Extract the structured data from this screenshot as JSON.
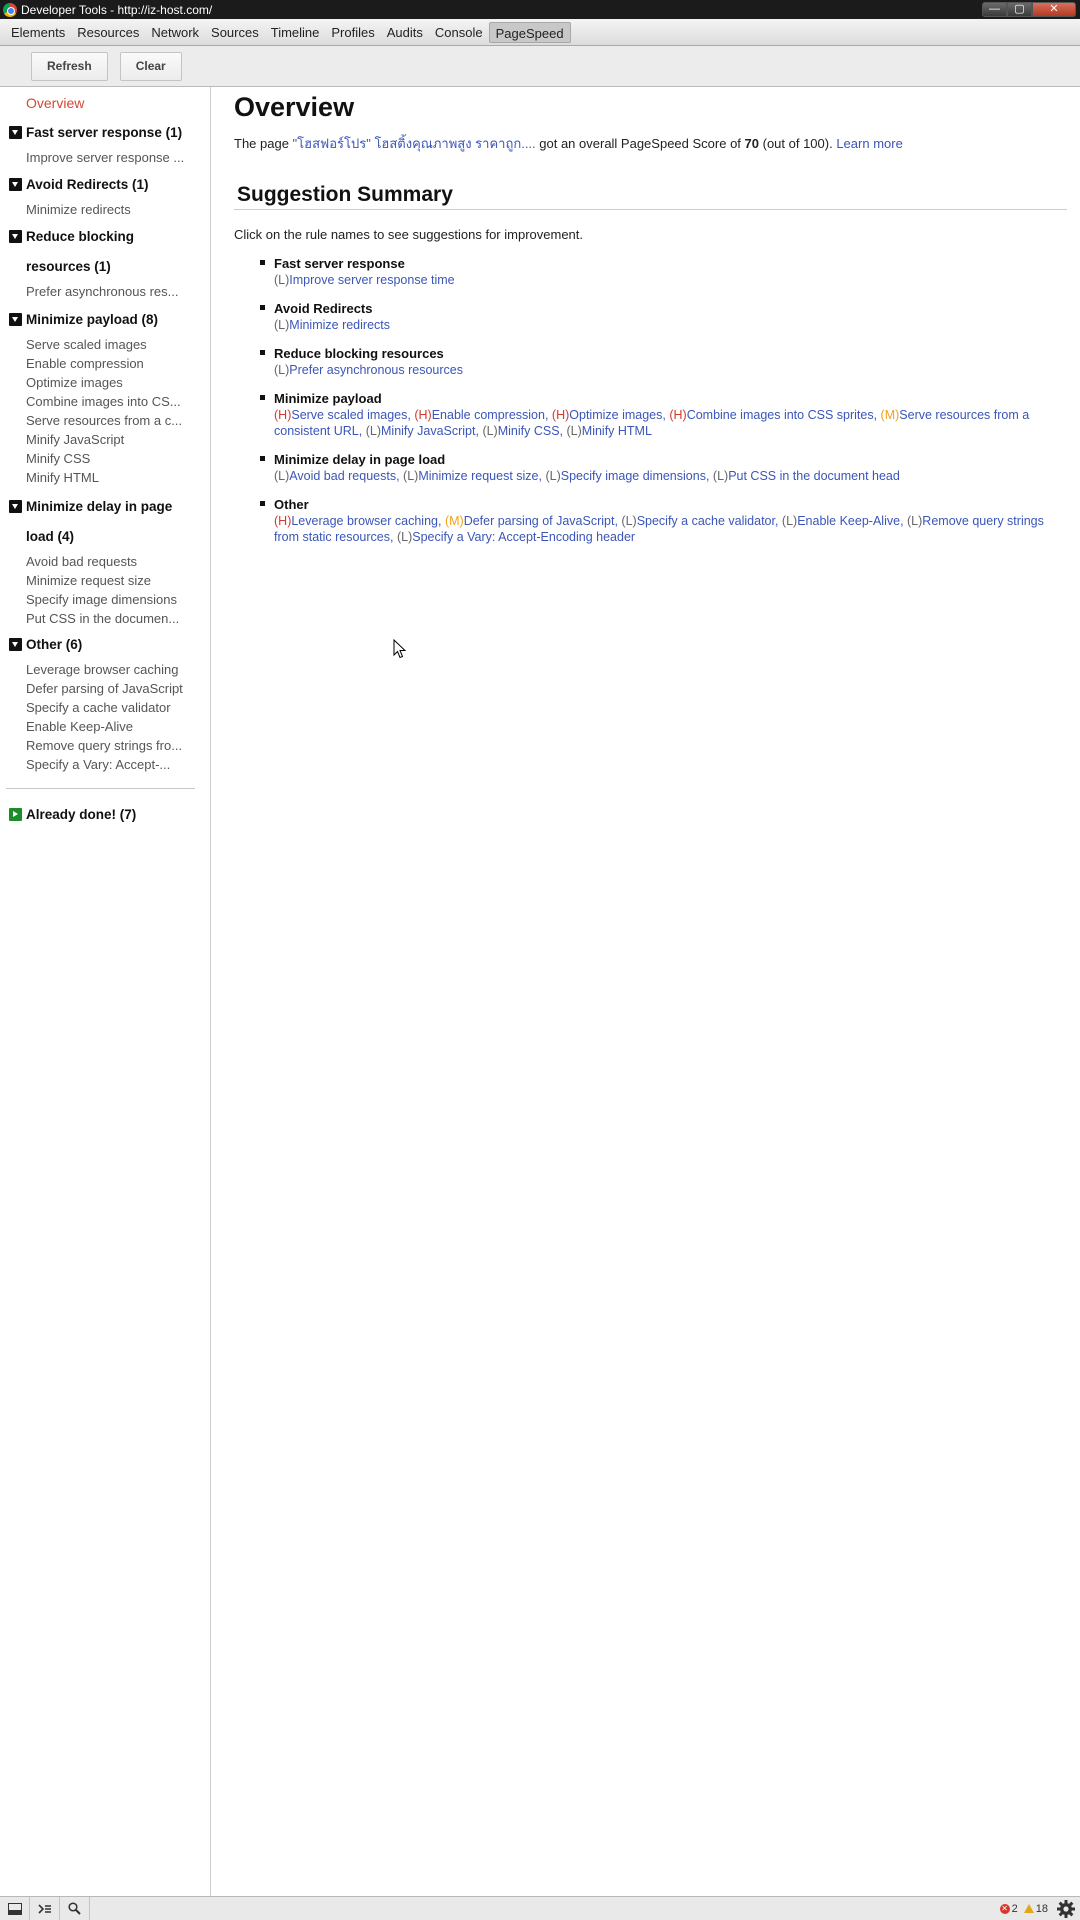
{
  "window": {
    "title": "Developer Tools - http://iz-host.com/",
    "minimize_glyph": "—",
    "maximize_glyph": "▢",
    "close_glyph": "✕"
  },
  "tabs": [
    "Elements",
    "Resources",
    "Network",
    "Sources",
    "Timeline",
    "Profiles",
    "Audits",
    "Console",
    "PageSpeed"
  ],
  "active_tab": "PageSpeed",
  "toolbar": {
    "refresh_label": "Refresh",
    "clear_label": "Clear"
  },
  "sidebar": {
    "overview_label": "Overview",
    "groups": [
      {
        "title": "Fast server response (1)",
        "items": [
          "Improve server response ..."
        ]
      },
      {
        "title": "Avoid Redirects (1)",
        "items": [
          "Minimize redirects"
        ]
      },
      {
        "title": "Reduce blocking resources (1)",
        "items": [
          "Prefer asynchronous res..."
        ]
      },
      {
        "title": "Minimize payload (8)",
        "items": [
          "Serve scaled images",
          "Enable compression",
          "Optimize images",
          "Combine images into CS...",
          "Serve resources from a c...",
          "Minify JavaScript",
          "Minify CSS",
          "Minify HTML"
        ]
      },
      {
        "title": "Minimize delay in page load (4)",
        "items": [
          "Avoid bad requests",
          "Minimize request size",
          "Specify image dimensions",
          "Put CSS in the documen..."
        ]
      },
      {
        "title": "Other (6)",
        "items": [
          "Leverage browser caching",
          "Defer parsing of JavaScript",
          "Specify a cache validator",
          "Enable Keep-Alive",
          "Remove query strings fro...",
          "Specify a Vary: Accept-..."
        ]
      }
    ],
    "done_label": "Already done! (7)"
  },
  "main": {
    "title": "Overview",
    "summary": {
      "prefix": "The page ",
      "page_link": "\"โฮสฟอร์โปร\" โฮสติ้งคุณภาพสูง ราคาถูก....",
      "middle": " got an overall PageSpeed Score of ",
      "score": "70",
      "suffix": " (out of 100). ",
      "learn_more": "Learn more"
    },
    "section_title": "Suggestion Summary",
    "section_desc": "Click on the rule names to see suggestions for improvement.",
    "rules": [
      {
        "name": "Fast server response",
        "suggestions": [
          {
            "priority": "(L)",
            "label": "Improve server response time"
          }
        ]
      },
      {
        "name": "Avoid Redirects",
        "suggestions": [
          {
            "priority": "(L)",
            "label": "Minimize redirects"
          }
        ]
      },
      {
        "name": "Reduce blocking resources",
        "suggestions": [
          {
            "priority": "(L)",
            "label": "Prefer asynchronous resources"
          }
        ]
      },
      {
        "name": "Minimize payload",
        "suggestions": [
          {
            "priority": "(H)",
            "label": "Serve scaled images"
          },
          {
            "priority": "(H)",
            "label": "Enable compression"
          },
          {
            "priority": "(H)",
            "label": "Optimize images"
          },
          {
            "priority": "(H)",
            "label": "Combine images into CSS sprites"
          },
          {
            "priority": "(M)",
            "label": "Serve resources from a consistent URL"
          },
          {
            "priority": "(L)",
            "label": "Minify JavaScript"
          },
          {
            "priority": "(L)",
            "label": "Minify CSS"
          },
          {
            "priority": "(L)",
            "label": "Minify HTML"
          }
        ]
      },
      {
        "name": "Minimize delay in page load",
        "suggestions": [
          {
            "priority": "(L)",
            "label": "Avoid bad requests"
          },
          {
            "priority": "(L)",
            "label": "Minimize request size"
          },
          {
            "priority": "(L)",
            "label": "Specify image dimensions"
          },
          {
            "priority": "(L)",
            "label": "Put CSS in the document head"
          }
        ]
      },
      {
        "name": "Other",
        "suggestions": [
          {
            "priority": "(H)",
            "label": "Leverage browser caching"
          },
          {
            "priority": "(M)",
            "label": "Defer parsing of JavaScript"
          },
          {
            "priority": "(L)",
            "label": "Specify a cache validator"
          },
          {
            "priority": "(L)",
            "label": "Enable Keep-Alive"
          },
          {
            "priority": "(L)",
            "label": "Remove query strings from static resources"
          },
          {
            "priority": "(L)",
            "label": "Specify a Vary: Accept-Encoding header"
          }
        ]
      }
    ]
  },
  "statusbar": {
    "error_count": "2",
    "warning_count": "18"
  },
  "colors": {
    "link": "#3a56b8",
    "high": "#d23a2e",
    "medium": "#f0a21b",
    "low": "#666666",
    "overview_active": "#d14836",
    "done_icon": "#1d8c2b"
  },
  "icons": {
    "dock": "dock-icon",
    "console": "console-icon",
    "search": "search-icon",
    "error": "error-icon",
    "warning": "warning-icon",
    "settings": "gear-icon"
  }
}
